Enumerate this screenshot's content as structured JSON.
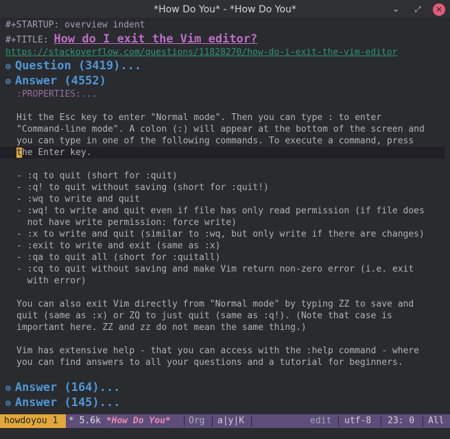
{
  "window": {
    "title": "*How Do You* - *How Do You*"
  },
  "buffer": {
    "startup_keyword": "#+STARTUP:",
    "startup_value": " overview indent",
    "title_keyword": "#+TITLE:",
    "title_value": "How do I exit the Vim editor?",
    "url": "https://stackoverflow.com/questions/11828270/how-do-i-exit-the-vim-editor",
    "headings": [
      {
        "bullet": "⊙",
        "text": "Question (3419)..."
      },
      {
        "bullet": "⊙",
        "text": "Answer (4552)"
      },
      {
        "bullet": "⊙",
        "text": "Answer (164)..."
      },
      {
        "bullet": "⊙",
        "text": "Answer (145)..."
      }
    ],
    "properties": ":PROPERTIES:...",
    "para1": [
      "Hit the Esc key to enter \"Normal mode\". Then you can type : to enter",
      "\"Command-line mode\". A colon (:) will appear at the bottom of the screen and",
      "you can type in one of the following commands. To execute a command, press"
    ],
    "para1_last_cursor": "t",
    "para1_last_rest": "he Enter key.",
    "list": [
      "- :q to quit (short for :quit)",
      "- :q! to quit without saving (short for :quit!)",
      "- :wq to write and quit",
      "- :wq! to write and quit even if file has only read permission (if file does",
      "  not have write permission: force write)",
      "- :x to write and quit (similar to :wq, but only write if there are changes)",
      "- :exit to write and exit (same as :x)",
      "- :qa to quit all (short for :quitall)",
      "- :cq to quit without saving and make Vim return non-zero error (i.e. exit",
      "  with error)"
    ],
    "para2": [
      "You can also exit Vim directly from \"Normal mode\" by typing ZZ to save and",
      "quit (same as :x) or ZQ to just quit (same as :q!). (Note that case is",
      "important here. ZZ and zz do not mean the same thing.)"
    ],
    "para3": [
      "Vim has extensive help - that you can access with the :help command - where",
      "you can find answers to all your questions and a tutorial for beginners."
    ]
  },
  "modeline": {
    "workspace": "howdoyou 1",
    "modified_marker": "* 5.6k ",
    "buffer_name": "*How Do You*",
    "major_mode": "Org",
    "minor_modes": "a|y|K",
    "state": "edit",
    "encoding": "utf-8",
    "position": "23: 0",
    "scroll": "All"
  },
  "colors": {
    "background": "#292b2e",
    "heading": "#4f97d7",
    "title": "#bc6ec5",
    "link": "#2d9574",
    "modeline": "#5d4d7a",
    "workspace": "#e3a83b"
  }
}
